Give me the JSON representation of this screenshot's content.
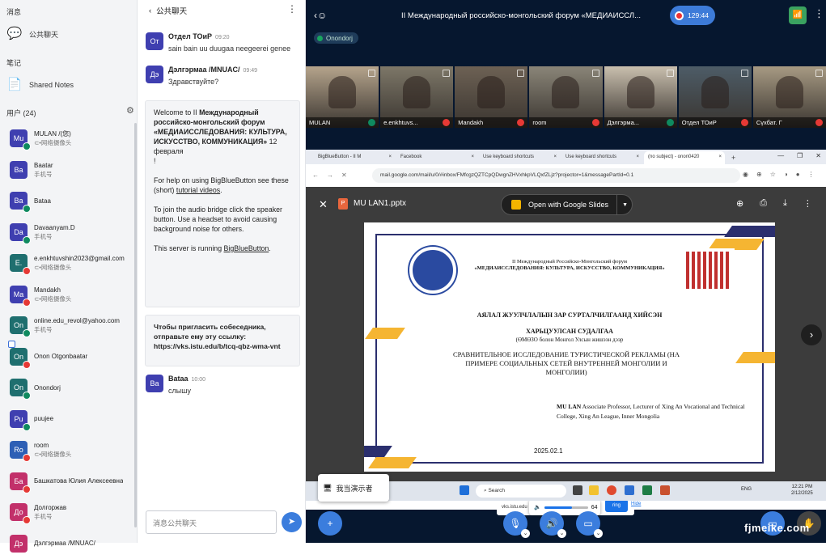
{
  "sidebar": {
    "messages_section": "消息",
    "public_chat_label": "公共聊天",
    "notes_section": "笔记",
    "shared_notes_label": "Shared Notes",
    "users_header": "用户 (24)",
    "users": [
      {
        "initials": "Mu",
        "name": "MULAN /(您)",
        "sub": "⊂•网络摄像头",
        "color": "#3f3fb0",
        "status": "mic"
      },
      {
        "initials": "Ba",
        "name": "Baatar",
        "sub": "手机号",
        "color": "#3f3fb0",
        "status": ""
      },
      {
        "initials": "Ba",
        "name": "Bataa",
        "sub": "",
        "color": "#3f3fb0",
        "status": "mic"
      },
      {
        "initials": "Da",
        "name": "Davaanyam.D",
        "sub": "手机号",
        "color": "#3f3fb0",
        "status": "mic"
      },
      {
        "initials": "E.",
        "name": "e.enkhtuvshin2023@gmail.com",
        "sub": "⊂•网络摄像头",
        "color": "#1f6f6f",
        "status": "mute"
      },
      {
        "initials": "Ma",
        "name": "Mandakh",
        "sub": "⊂•网络摄像头",
        "color": "#3f3fb0",
        "status": "mute"
      },
      {
        "initials": "On",
        "name": "online.edu_revol@yahoo.com",
        "sub": "手机号",
        "color": "#1f6f6f",
        "status": "mic"
      },
      {
        "initials": "On",
        "name": "Onon Otgonbaatar",
        "sub": "",
        "color": "#1f6f6f",
        "status": "mute",
        "presenter": true
      },
      {
        "initials": "On",
        "name": "Onondorj",
        "sub": "",
        "color": "#1f6f6f",
        "status": "mic"
      },
      {
        "initials": "Pu",
        "name": "puujee",
        "sub": "",
        "color": "#3f3fb0",
        "status": "mic"
      },
      {
        "initials": "Ro",
        "name": "room",
        "sub": "⊂•网络摄像头",
        "color": "#2d5fb5",
        "status": "mute"
      },
      {
        "initials": "Ба",
        "name": "Башкатова Юлия Алексеевна",
        "sub": "",
        "color": "#c2306a",
        "status": "mute"
      },
      {
        "initials": "До",
        "name": "Долгоржав",
        "sub": "手机号",
        "color": "#c2306a",
        "status": "mute"
      },
      {
        "initials": "Дэ",
        "name": "Дэлгэрмаа /MNUAC/",
        "sub": "",
        "color": "#c2306a",
        "status": ""
      }
    ]
  },
  "chat": {
    "title": "公共聊天",
    "messages": [
      {
        "initials": "От",
        "color": "#3f3fb0",
        "name": "Отдел ТОиР",
        "time": "09:20",
        "text": "sain bain uu duugaa neegeerei genee"
      },
      {
        "initials": "Дэ",
        "color": "#3f3fb0",
        "name": "Дэлгэрмаа /MNUAC/",
        "time": "09:49",
        "text": "Здравствуйте?"
      },
      {
        "initials": "Ba",
        "color": "#3f3fb0",
        "name": "Bataa",
        "time": "10:00",
        "text": "слышу"
      }
    ],
    "welcome": {
      "intro": "Welcome to II ",
      "bold": "Международный российско-монгольский форум «МЕДИАИССЛЕДОВАНИЯ: КУЛЬТУРА, ИСКУССТВО, КОММУНИКАЦИЯ»",
      "date": " 12 февраля",
      "bang": "!",
      "help_pre": "For help on using BigBlueButton see these (short) ",
      "help_link": "tutorial videos",
      "help_post": ".",
      "audio": "To join the audio bridge click the speaker button. Use a headset to avoid causing background noise for others.",
      "server_pre": "This server is running ",
      "server_link": "BigBlueButton",
      "server_post": "."
    },
    "invite": "Чтобы пригласить собеседника, отправьте ему эту ссылку: https://vks.istu.edu/b/tcq-qbz-wma-vnt",
    "input_placeholder": "消息公共聊天"
  },
  "meeting": {
    "title": "II Международный российско-монгольский форум «МЕДИАИССЛ...",
    "timer": "129:44",
    "talking": "Onondorj"
  },
  "tiles": [
    {
      "name": "MULAN",
      "bg": "#b5a48c",
      "status": "mic"
    },
    {
      "name": "e.enkhtuvs...",
      "bg": "#7d7768",
      "status": "mute"
    },
    {
      "name": "Mandakh",
      "bg": "#6d6154",
      "status": "mute"
    },
    {
      "name": "room",
      "bg": "#8a8578",
      "status": "mute"
    },
    {
      "name": "Дэлгэрма...",
      "bg": "#c9bfae",
      "status": "mic"
    },
    {
      "name": "Отдел ТОиР",
      "bg": "#4d5c67",
      "status": "mute"
    },
    {
      "name": "Сүхбат. Г",
      "bg": "#a79a83",
      "status": "mute"
    }
  ],
  "browser": {
    "tabs": [
      "BigBlueButton - II M",
      "Facebook",
      "Use keyboard shortcuts",
      "Use keyboard shortcuts",
      "(no subject) - onon0420"
    ],
    "url": "mail.google.com/mail/u/0/#inbox/FMfcgzQZTCpQDwgnZHVxhkpVLQxfZLjz?projector=1&messagePartId=0.1",
    "file_name": "MU LAN1.pptx",
    "open_with": "Open with Google Slides",
    "volume": "64",
    "share_text": "vks.istu.edu",
    "share_button": "ring",
    "share_hide": "Hide",
    "search": "Search",
    "lang": "ENG",
    "clock_time": "12:21 PM",
    "clock_date": "2/12/2025"
  },
  "slide": {
    "header1": "II Международный Российско-Монгольский форум",
    "header2": "«МЕДИАИССЛЕДОВАНИЯ: КУЛЬТУРА, ИСКУССТВО, КОММУНИКАЦИЯ»",
    "mn_title": "АЯЛАЛ ЖУУЛЧЛАЛЫН ЗАР СУРТАЛЧИЛГААНД ХИЙСЭН",
    "mn_title2": "ХАРЬЦУУЛСАН СУДАЛГАА",
    "mn_sub": "(ӨМӨЗО болон Монгол Улсын жишээн дээр",
    "ru_title": "СРАВНИТЕЛЬНОЕ ИССЛЕДОВАНИЕ ТУРИСТИЧЕСКОЙ РЕКЛАМЫ (НА ПРИМЕРЕ СОЦИАЛЬНЫХ СЕТЕЙ ВНУТРЕННЕЙ МОНГОЛИИ И МОНГОЛИИ)",
    "author_bold": "MU LAN",
    "author_rest": " Associate Professor, Lecturer of Xing An Vocational and Technical College, Xing An League, Inner Mongolia",
    "date": "2025.02.1"
  },
  "presenter_button": "我当演示者",
  "watermark": "fjmeike.com",
  "colors": {
    "accent": "#3b7ddd",
    "dark_bg": "#06172f",
    "yellow_stripe": "#f5b532",
    "navy_stripe": "#2b2f6e"
  }
}
